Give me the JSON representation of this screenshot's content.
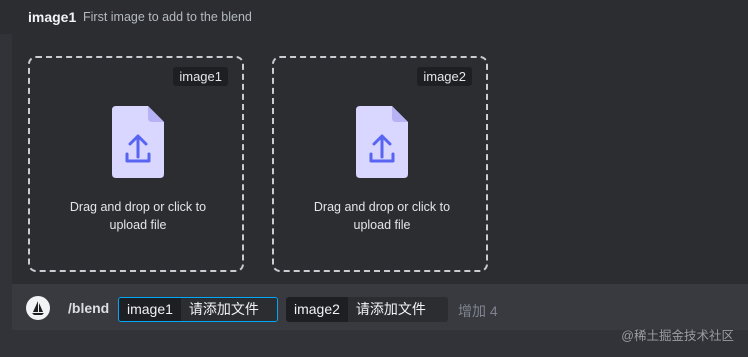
{
  "option": {
    "name": "image1",
    "description": "First image to add to the blend"
  },
  "dropzones": [
    {
      "tag": "image1",
      "line1": "Drag and drop or click to",
      "line2": "upload file"
    },
    {
      "tag": "image2",
      "line1": "Drag and drop or click to",
      "line2": "upload file"
    }
  ],
  "icons": {
    "file_upload": "file-upload-icon",
    "avatar": "sailboat-avatar"
  },
  "command": {
    "name": "/blend",
    "params": [
      {
        "key": "image1",
        "value": "请添加文件"
      },
      {
        "key": "image2",
        "value": "请添加文件"
      }
    ],
    "more": "增加 4"
  },
  "watermark": "@稀土掘金技术社区",
  "colors": {
    "background": "#313338",
    "panel": "#2b2d31",
    "command_bar": "#383a40",
    "focus_border": "#00a8fc",
    "file_icon_fill": "#d9d6ff",
    "file_icon_arrow": "#5865f2"
  }
}
